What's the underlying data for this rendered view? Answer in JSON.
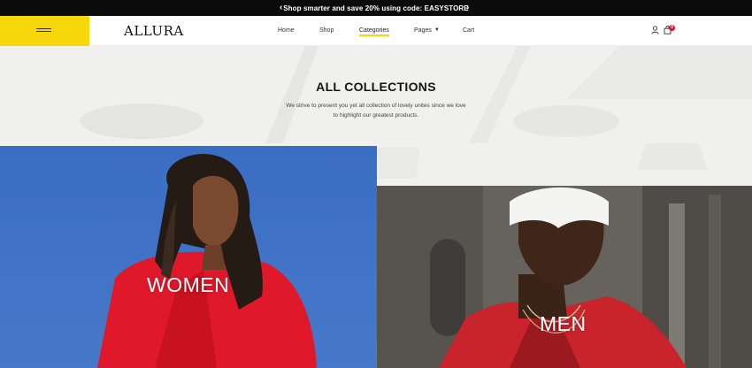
{
  "announcement": {
    "text": "Shop smarter and save 20% using code: EASYSTORE",
    "prev_icon": "chevron-left-icon",
    "next_icon": "chevron-right-icon"
  },
  "header": {
    "logo": "ALLURA",
    "menu_icon": "hamburger-icon",
    "nav": [
      {
        "label": "Home"
      },
      {
        "label": "Shop"
      },
      {
        "label": "Categories",
        "active": true
      },
      {
        "label": "Pages",
        "has_dropdown": true
      },
      {
        "label": "Cart"
      }
    ],
    "account_icon": "user-icon",
    "cart_icon": "shopping-bag-icon",
    "cart_count": "0"
  },
  "hero": {
    "title": "ALL COLLECTIONS",
    "description": "We strive to present you yet all collection of lovely unites since we love to highlight our greatest products."
  },
  "collections": [
    {
      "label": "WOMEN"
    },
    {
      "label": "MEN"
    }
  ],
  "colors": {
    "accent_yellow": "#f6d70b",
    "topbar_black": "#0b0b0b",
    "badge_red": "#d8102b",
    "sky_blue": "#3b6fc2",
    "jacket_red": "#e0192a"
  }
}
